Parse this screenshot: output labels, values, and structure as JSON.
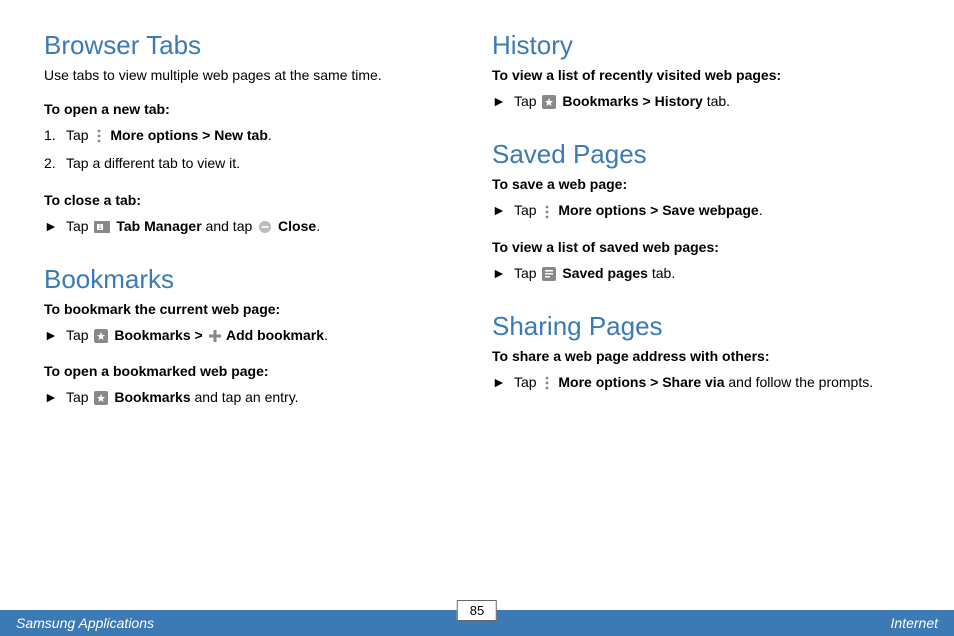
{
  "left": {
    "browserTabs": {
      "heading": "Browser Tabs",
      "intro": "Use tabs to view multiple web pages at the same time.",
      "openHeading": "To open a new tab:",
      "step1num": "1.",
      "step1_a": "Tap ",
      "step1_b": " More options",
      "step1_c": " > ",
      "step1_d": "New tab",
      "step1_e": ".",
      "step2num": "2.",
      "step2": "Tap a different tab to view it.",
      "closeHeading": "To close a tab:",
      "close_a": "Tap ",
      "close_b": " Tab Manager",
      "close_c": " and tap ",
      "close_d": " Close",
      "close_e": "."
    },
    "bookmarks": {
      "heading": "Bookmarks",
      "bmHeading": "To bookmark the current web page:",
      "bm_a": "Tap ",
      "bm_b": " Bookmarks",
      "bm_c": " > ",
      "bm_d": " Add bookmark",
      "bm_e": ".",
      "openHeading": "To open a bookmarked web page:",
      "open_a": "Tap ",
      "open_b": " Bookmarks",
      "open_c": " and tap an entry."
    }
  },
  "right": {
    "history": {
      "heading": "History",
      "sub": "To view a list of recently visited web pages:",
      "a": "Tap ",
      "b": " Bookmarks",
      "c": " > ",
      "d": "History",
      "e": " tab."
    },
    "saved": {
      "heading": "Saved Pages",
      "saveHeading": "To save a web page:",
      "save_a": "Tap ",
      "save_b": " More options",
      "save_c": " > ",
      "save_d": "Save webpage",
      "save_e": ".",
      "viewHeading": "To view a list of saved web pages:",
      "view_a": "Tap ",
      "view_b": " Saved pages",
      "view_c": " tab."
    },
    "sharing": {
      "heading": "Sharing Pages",
      "sub": "To share a web page address with others:",
      "a": "Tap ",
      "b": " More options",
      "c": " > ",
      "d": "Share via",
      "e": " and follow the prompts."
    }
  },
  "footer": {
    "left": "Samsung Applications",
    "center": "85",
    "right": "Internet"
  },
  "bullet": "►"
}
